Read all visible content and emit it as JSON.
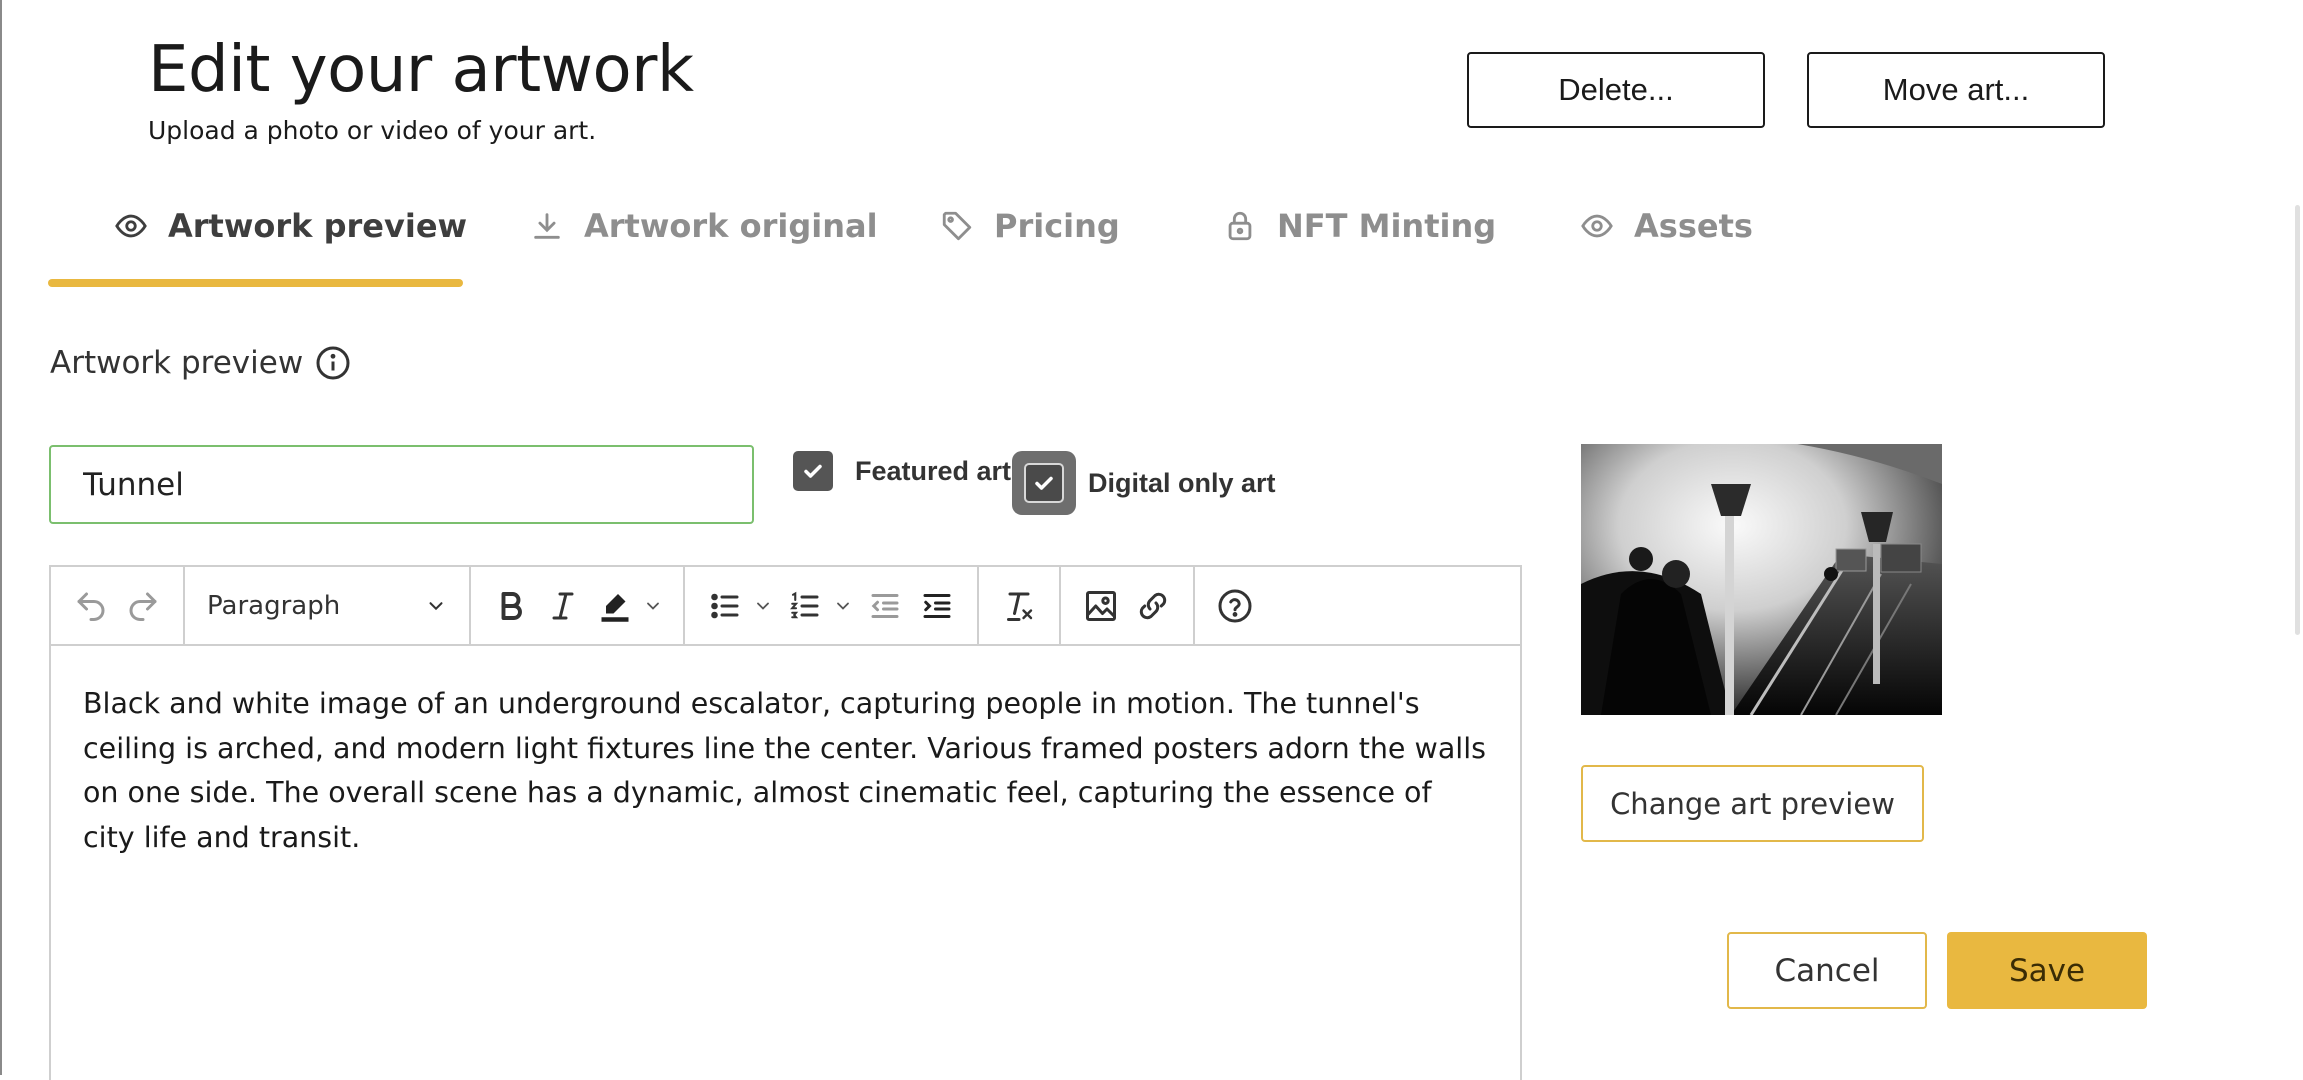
{
  "header": {
    "title": "Edit your artwork",
    "subtitle": "Upload a photo or video of your art.",
    "delete_label": "Delete...",
    "move_label": "Move art..."
  },
  "tabs": [
    {
      "label": "Artwork preview",
      "icon": "eye-icon",
      "active": true
    },
    {
      "label": "Artwork original",
      "icon": "download-icon",
      "active": false
    },
    {
      "label": "Pricing",
      "icon": "tag-icon",
      "active": false
    },
    {
      "label": "NFT Minting",
      "icon": "lock-icon",
      "active": false
    },
    {
      "label": "Assets",
      "icon": "eye-icon",
      "active": false
    }
  ],
  "colors": {
    "accent": "#e9b840",
    "input_border": "#7bbf6e",
    "outline_button": "#e2b84a"
  },
  "form": {
    "section_label": "Artwork preview",
    "section_icon": "info-icon",
    "name_value": "Tunnel",
    "featured_label": "Featured art",
    "featured_checked": true,
    "digital_label": "Digital only art",
    "digital_checked": true
  },
  "editor": {
    "block_format": "Paragraph",
    "toolbar": [
      "undo-icon",
      "redo-icon",
      "bold-icon",
      "italic-icon",
      "highlight-icon",
      "bullet-list-icon",
      "numbered-list-icon",
      "outdent-icon",
      "indent-icon",
      "clear-format-icon",
      "image-icon",
      "link-icon",
      "help-icon"
    ],
    "content": "Black and white image of an underground escalator, capturing people in motion. The tunnel's ceiling is arched, and modern light fixtures line the center. Various framed posters adorn the walls on one side. The overall scene has a dynamic, almost cinematic feel, capturing the essence of city life and transit."
  },
  "preview": {
    "change_label": "Change art preview"
  },
  "footer": {
    "cancel_label": "Cancel",
    "save_label": "Save"
  }
}
